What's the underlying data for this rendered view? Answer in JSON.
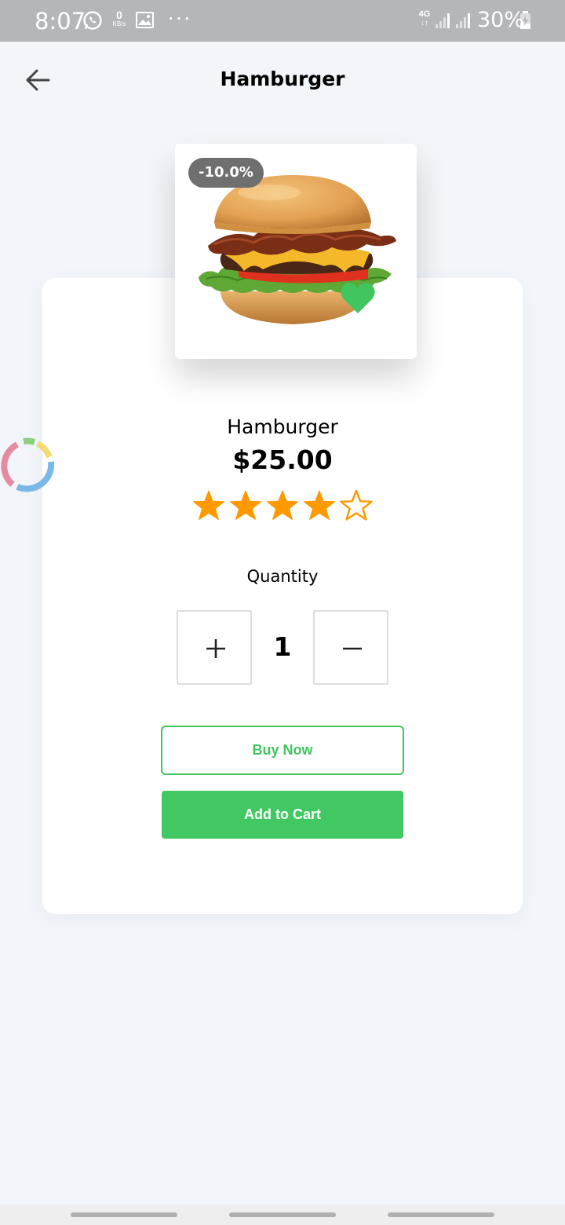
{
  "status_bar": {
    "time": "8:07",
    "net_speed_value": "0",
    "net_speed_unit": "KB/s",
    "more_indicator": "···",
    "network_type": "4G",
    "battery": "30%",
    "icons": [
      "whatsapp-icon",
      "gallery-icon",
      "signal-icon",
      "signal-icon",
      "battery-charging-icon"
    ]
  },
  "header": {
    "title": "Hamburger",
    "back_icon": "arrow-left-icon"
  },
  "product": {
    "discount_badge": "-10.0%",
    "name": "Hamburger",
    "price": "$25.00",
    "rating": 4,
    "rating_max": 5,
    "favorited": true,
    "favorite_icon": "heart-icon"
  },
  "quantity": {
    "label": "Quantity",
    "value": "1",
    "increment_icon": "plus-icon",
    "decrement_icon": "minus-icon"
  },
  "actions": {
    "buy_now": "Buy Now",
    "add_to_cart": "Add to Cart"
  },
  "colors": {
    "accent_green": "#41c862",
    "star_orange": "#ff9900",
    "badge_gray": "#6f6f6f",
    "background": "#f2f5f9"
  }
}
